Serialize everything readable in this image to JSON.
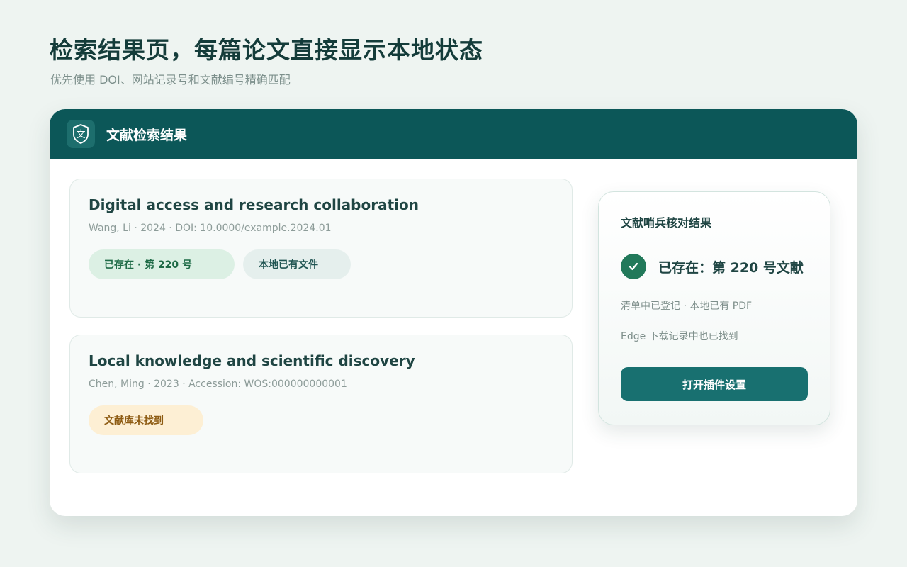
{
  "hero": {
    "title": "检索结果页，每篇论文直接显示本地状态",
    "subtitle": "优先使用 DOI、网站记录号和文献编号精确匹配"
  },
  "panel": {
    "logo_icon": "book-shield-icon",
    "logo_glyph": "文",
    "title": "文献检索结果"
  },
  "results": [
    {
      "title": "Digital access and research collaboration",
      "meta": "Wang, Li · 2024 · DOI: 10.0000/example.2024.01",
      "tags": [
        {
          "label": "已存在 · 第 220 号",
          "kind": "found"
        },
        {
          "label": "本地已有文件",
          "kind": "local"
        }
      ]
    },
    {
      "title": "Local knowledge and scientific discovery",
      "meta": "Chen, Ming · 2023 · Accession: WOS:000000000001",
      "tags": [
        {
          "label": "文献库未找到",
          "kind": "missing"
        }
      ]
    }
  ],
  "popup": {
    "title": "文献哨兵核对结果",
    "status_icon": "check-icon",
    "status": "已存在：第 220 号文献",
    "detail_1": "清单中已登记 · 本地已有 PDF",
    "detail_2": "Edge 下载记录中也已找到",
    "button_label": "打开插件设置"
  },
  "colors": {
    "brand": "#0c5758",
    "button": "#187070",
    "found_bg": "#dcf0e4",
    "missing_bg": "#fdefd4",
    "check": "#22795a"
  }
}
